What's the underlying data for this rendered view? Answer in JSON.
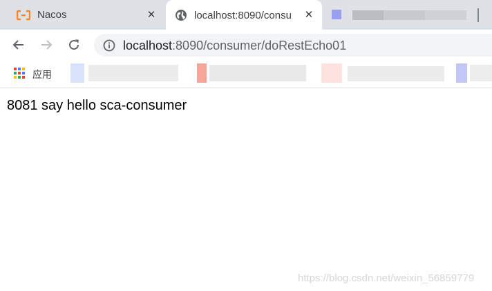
{
  "tabs": [
    {
      "title": "Nacos",
      "icon": "alibaba-cloud-icon",
      "close_label": "✕",
      "active": false
    },
    {
      "title": "localhost:8090/consu",
      "icon": "globe-icon",
      "close_label": "✕",
      "active": true
    }
  ],
  "toolbar": {
    "back_icon": "arrow-back-icon",
    "forward_icon": "arrow-forward-icon",
    "reload_icon": "reload-icon",
    "url_host": "localhost",
    "url_rest": ":8090/consumer/doRestEcho01"
  },
  "bookmarks": {
    "apps_label": "应用"
  },
  "page": {
    "body_text": "8081 say hello sca-consumer"
  },
  "watermark": "https://blog.csdn.net/weixin_56859779",
  "colors": {
    "tabstrip_bg": "#dee1e6",
    "active_tab_bg": "#ffffff",
    "omnibox_bg": "#f1f3f4",
    "nacos_icon": "#f5862a",
    "watermark": "#d6d6d6"
  }
}
